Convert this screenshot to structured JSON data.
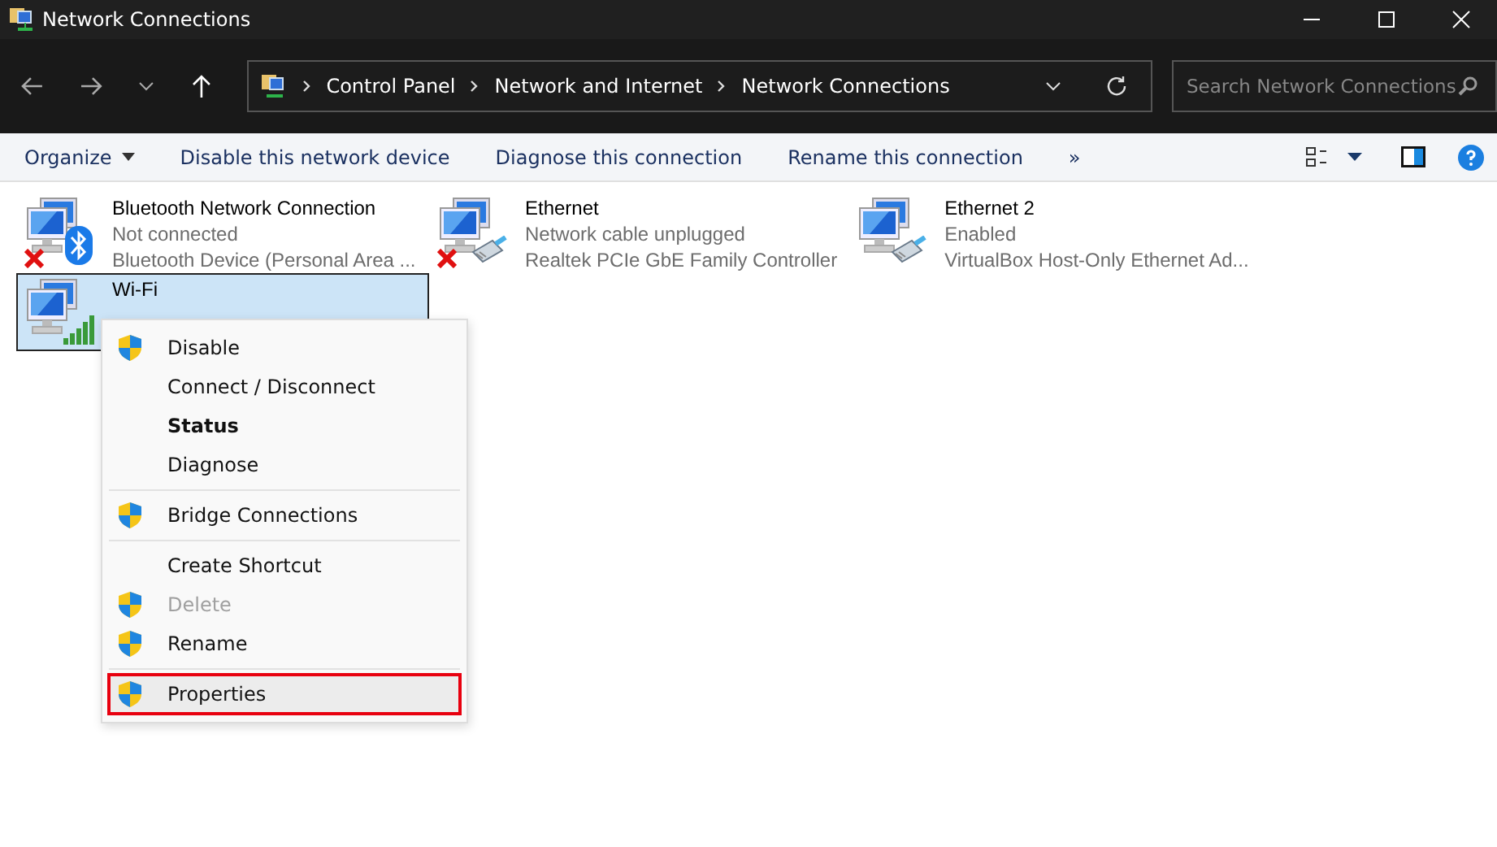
{
  "window": {
    "title": "Network Connections"
  },
  "address_bar": {
    "crumbs": [
      "Control Panel",
      "Network and Internet",
      "Network Connections"
    ]
  },
  "search": {
    "placeholder": "Search Network Connections"
  },
  "command_bar": {
    "items": [
      {
        "label": "Organize",
        "menu": true
      },
      {
        "label": "Disable this network device",
        "menu": false
      },
      {
        "label": "Diagnose this connection",
        "menu": false
      },
      {
        "label": "Rename this connection",
        "menu": false
      },
      {
        "label": "»",
        "menu": false
      }
    ]
  },
  "connections": [
    {
      "name": "Bluetooth Network Connection",
      "status": "Not connected",
      "device": "Bluetooth Device (Personal Area ...",
      "kind": "bluetooth",
      "disconnected": true,
      "selected": false
    },
    {
      "name": "Ethernet",
      "status": "Network cable unplugged",
      "device": "Realtek PCIe GbE Family Controller",
      "kind": "ethernet",
      "disconnected": true,
      "selected": false
    },
    {
      "name": "Ethernet 2",
      "status": "Enabled",
      "device": "VirtualBox Host-Only Ethernet Ad...",
      "kind": "ethernet",
      "disconnected": false,
      "selected": false
    },
    {
      "name": "Wi-Fi",
      "kind": "wifi",
      "disconnected": false,
      "selected": true
    }
  ],
  "context_menu": {
    "items": [
      {
        "kind": "item",
        "label": "Disable",
        "shield": true,
        "bold": false,
        "disabled": false,
        "selected": false
      },
      {
        "kind": "item",
        "label": "Connect / Disconnect",
        "shield": false,
        "bold": false,
        "disabled": false,
        "selected": false
      },
      {
        "kind": "item",
        "label": "Status",
        "shield": false,
        "bold": true,
        "disabled": false,
        "selected": false
      },
      {
        "kind": "item",
        "label": "Diagnose",
        "shield": false,
        "bold": false,
        "disabled": false,
        "selected": false
      },
      {
        "kind": "separator"
      },
      {
        "kind": "item",
        "label": "Bridge Connections",
        "shield": true,
        "bold": false,
        "disabled": false,
        "selected": false
      },
      {
        "kind": "separator"
      },
      {
        "kind": "item",
        "label": "Create Shortcut",
        "shield": false,
        "bold": false,
        "disabled": false,
        "selected": false
      },
      {
        "kind": "item",
        "label": "Delete",
        "shield": true,
        "bold": false,
        "disabled": true,
        "selected": false
      },
      {
        "kind": "item",
        "label": "Rename",
        "shield": true,
        "bold": false,
        "disabled": false,
        "selected": false
      },
      {
        "kind": "separator"
      },
      {
        "kind": "item",
        "label": "Properties",
        "shield": true,
        "bold": false,
        "disabled": false,
        "selected": true
      }
    ]
  }
}
